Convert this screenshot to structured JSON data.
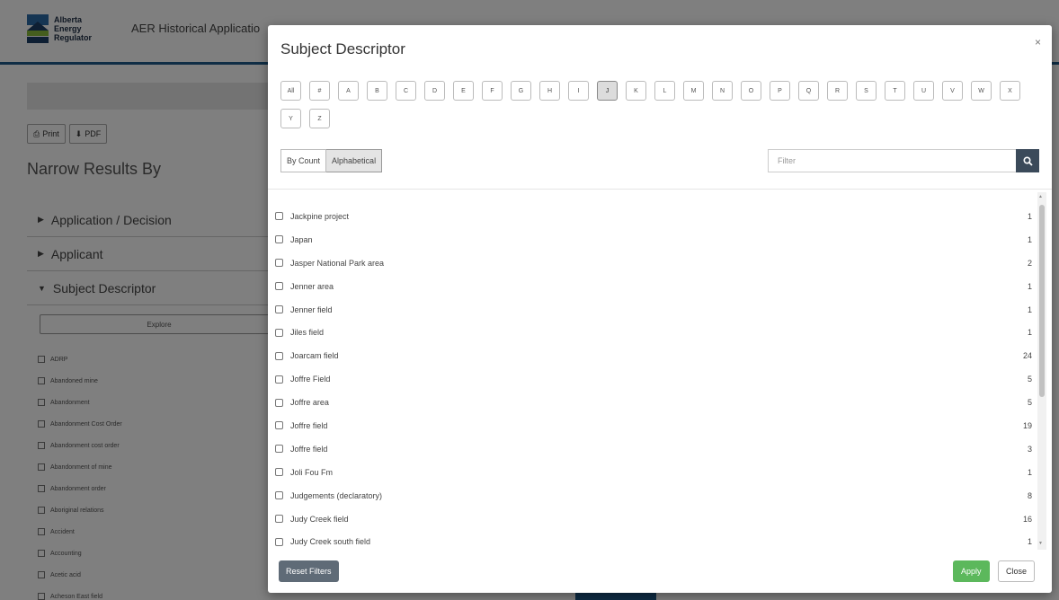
{
  "header": {
    "logo_lines": [
      "Alberta",
      "Energy",
      "Regulator"
    ],
    "app_title": "AER Historical Applicatio"
  },
  "sidebar": {
    "print_label": "Print",
    "pdf_label": "PDF",
    "narrow_title": "Narrow Results By",
    "accordions": [
      "Application / Decision",
      "Applicant",
      "Subject Descriptor"
    ],
    "explore_label": "Explore",
    "items": [
      "ADRP",
      "Abandoned mine",
      "Abandonment",
      "Abandonment Cost Order",
      "Abandonment cost order",
      "Abandonment of mine",
      "Abandonment order",
      "Aboriginal relations",
      "Accident",
      "Accounting",
      "Acetic acid",
      "Acheson East field"
    ]
  },
  "modal": {
    "title": "Subject Descriptor",
    "close_symbol": "×",
    "letters": [
      "All",
      "#",
      "A",
      "B",
      "C",
      "D",
      "E",
      "F",
      "G",
      "H",
      "I",
      "J",
      "K",
      "L",
      "M",
      "N",
      "O",
      "P",
      "Q",
      "R",
      "S",
      "T",
      "U",
      "V",
      "W",
      "X",
      "Y",
      "Z"
    ],
    "active_letter": "J",
    "sort": {
      "by_count": "By Count",
      "alphabetical": "Alphabetical",
      "active": "Alphabetical"
    },
    "filter_placeholder": "Filter",
    "results": [
      {
        "label": "Jackpine project",
        "count": "1"
      },
      {
        "label": "Japan",
        "count": "1"
      },
      {
        "label": "Jasper National Park area",
        "count": "2"
      },
      {
        "label": "Jenner area",
        "count": "1"
      },
      {
        "label": "Jenner field",
        "count": "1"
      },
      {
        "label": "Jiles field",
        "count": "1"
      },
      {
        "label": "Joarcam field",
        "count": "24"
      },
      {
        "label": "Joffre Field",
        "count": "5"
      },
      {
        "label": "Joffre area",
        "count": "5"
      },
      {
        "label": "Joffre field",
        "count": "19"
      },
      {
        "label": "Joffre field",
        "count": "3"
      },
      {
        "label": "Joli Fou Fm",
        "count": "1"
      },
      {
        "label": "Judgements (declaratory)",
        "count": "8"
      },
      {
        "label": "Judy Creek field",
        "count": "16"
      },
      {
        "label": "Judy Creek south field",
        "count": "1"
      }
    ],
    "reset_label": "Reset Filters",
    "apply_label": "Apply",
    "close_label": "Close"
  },
  "colors": {
    "brand_blue": "#1f5a8a",
    "apply_green": "#5cb85c",
    "reset_gray": "#5f6b77"
  }
}
